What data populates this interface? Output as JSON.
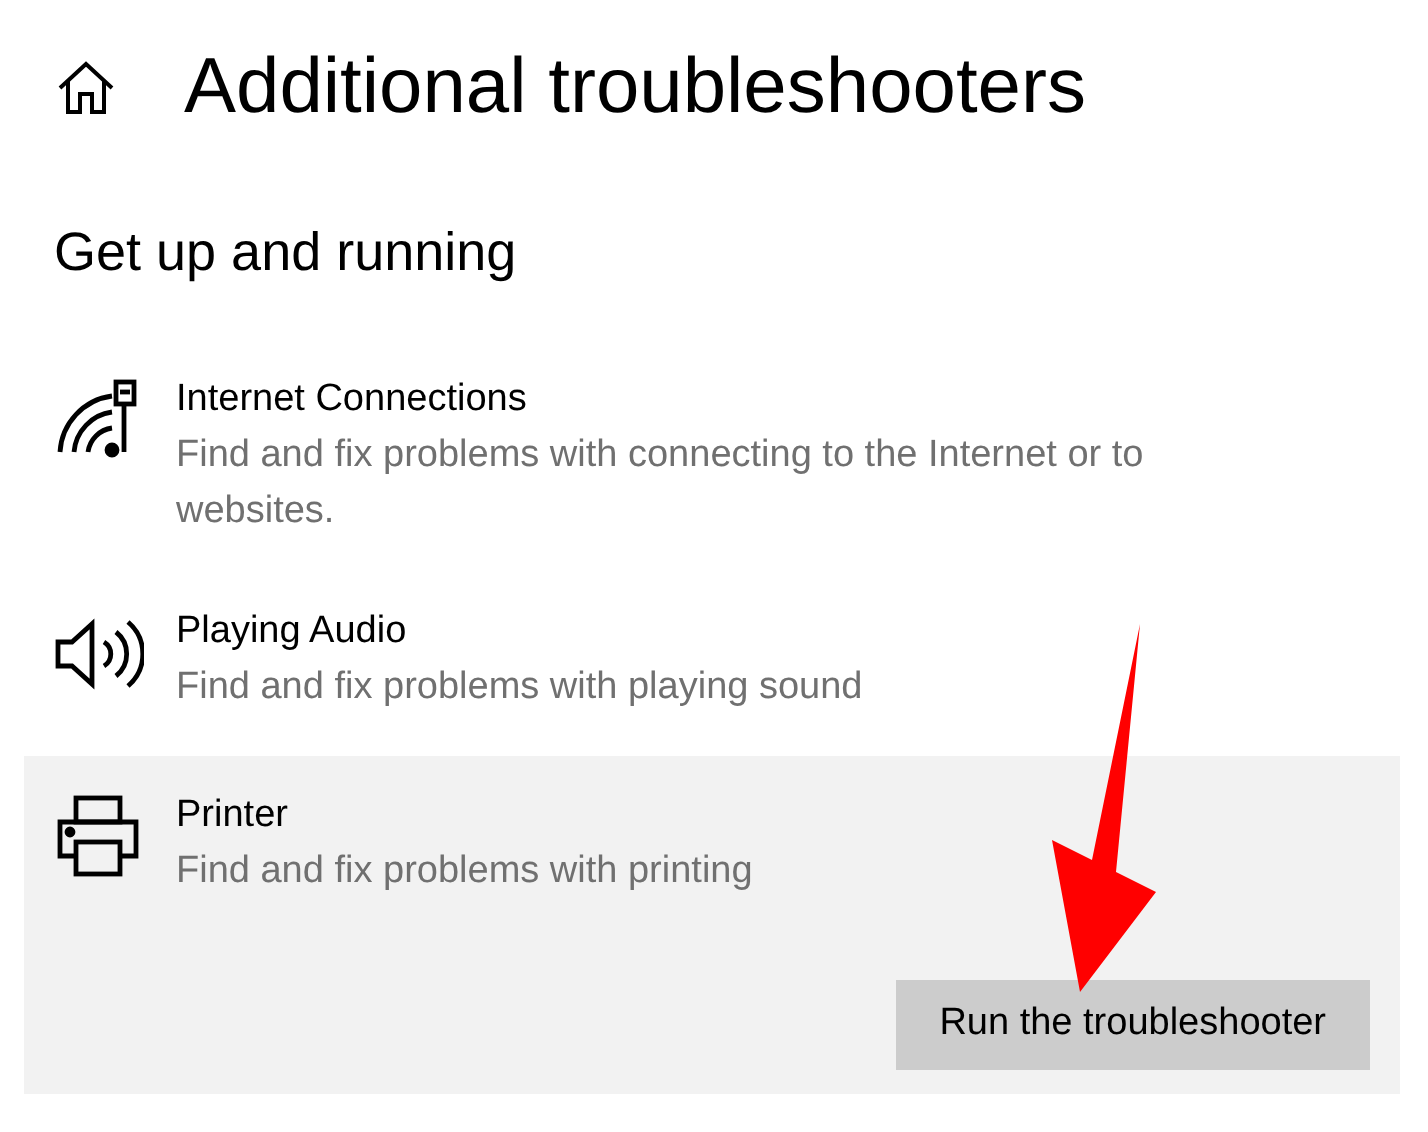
{
  "header": {
    "title": "Additional troubleshooters"
  },
  "section": {
    "title": "Get up and running"
  },
  "items": [
    {
      "kind": "internet",
      "title": "Internet Connections",
      "description": "Find and fix problems with connecting to the Internet or to websites.",
      "selected": false
    },
    {
      "kind": "audio",
      "title": "Playing Audio",
      "description": "Find and fix problems with playing sound",
      "selected": false
    },
    {
      "kind": "printer",
      "title": "Printer",
      "description": "Find and fix problems with printing",
      "selected": true,
      "button": "Run the troubleshooter"
    }
  ]
}
